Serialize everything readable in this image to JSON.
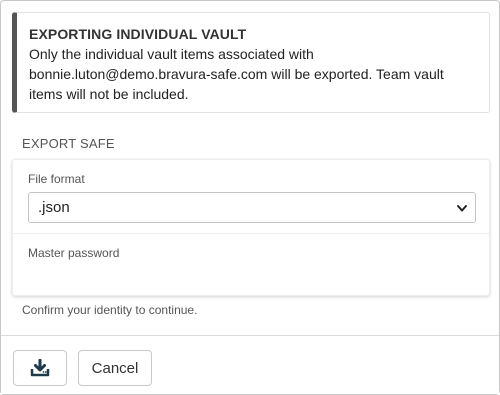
{
  "callout": {
    "title": "EXPORTING INDIVIDUAL VAULT",
    "text": "Only the individual vault items associated with bonnie.luton@demo.bravura-safe.com will be exported. Team vault items will not be included."
  },
  "section": {
    "title": "EXPORT SAFE"
  },
  "form": {
    "file_format_label": "File format",
    "file_format_value": ".json",
    "master_password_label": "Master password",
    "master_password_value": ""
  },
  "hint": "Confirm your identity to continue.",
  "footer": {
    "export_icon": "download-icon",
    "cancel_label": "Cancel"
  },
  "colors": {
    "accent_dark": "#1e3a4c",
    "callout_border": "#555555"
  }
}
